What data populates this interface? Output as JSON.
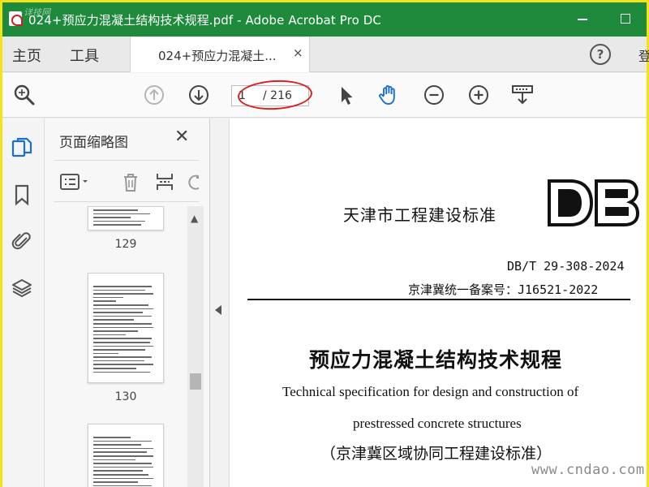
{
  "window": {
    "title": "024+预应力混凝土结构技术规程.pdf - Adobe Acrobat Pro DC",
    "watermark_top": "详技网"
  },
  "tabs": {
    "home": "主页",
    "tools": "工具",
    "document": "024+预应力混凝土...",
    "close": "×",
    "help": "?",
    "signin": "登"
  },
  "toolbar": {
    "page_current": "1",
    "page_total": "/ 216"
  },
  "thumb_panel": {
    "title": "页面缩略图",
    "close": "✕",
    "pages": [
      "129",
      "130"
    ]
  },
  "document": {
    "header": "天津市工程建设标准",
    "logo": "DB",
    "code": "DB/T 29-308-2024",
    "record": "京津冀统一备案号：J16521-2022",
    "title_cn": "预应力混凝土结构技术规程",
    "title_en_1": "Technical specification for design and construction of",
    "title_en_2": "prestressed concrete structures",
    "subtitle": "（京津冀区域协同工程建设标准）"
  },
  "watermark": "www.cndao.com",
  "colors": {
    "titlebar": "#1e8a3c",
    "frame": "#f5e31a",
    "annotation": "#d42222",
    "hand_tool": "#1a6fd1"
  }
}
